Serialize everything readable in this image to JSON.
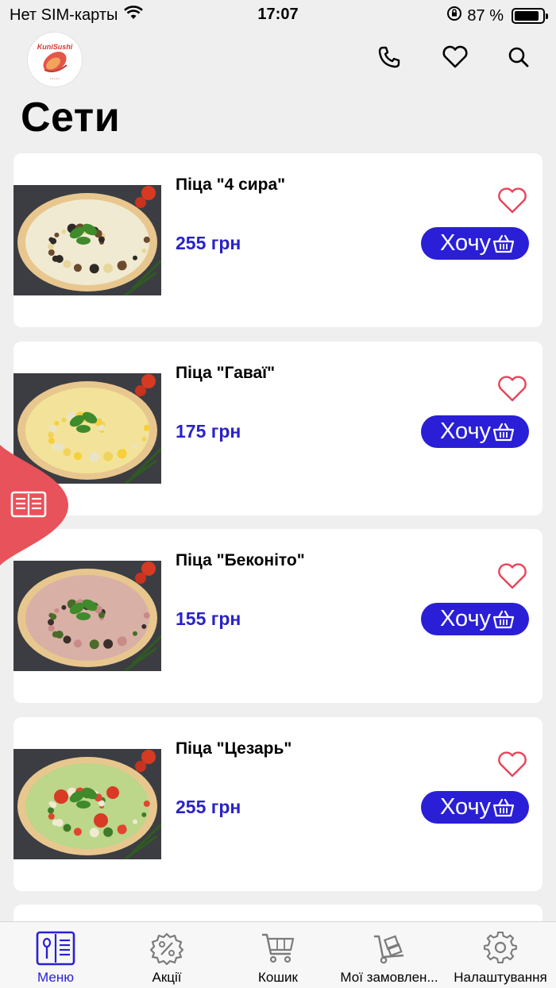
{
  "status": {
    "carrier": "Нет SIM-карты",
    "time": "17:07",
    "battery_text": "87 %",
    "battery_level": 0.87
  },
  "header": {
    "logo_text": "KuniSushi",
    "phone_icon": "phone-icon",
    "favorites_icon": "heart-icon",
    "search_icon": "search-icon"
  },
  "page": {
    "title": "Сети"
  },
  "products": [
    {
      "name": "Піца \"4 сира\"",
      "price": "255 грн",
      "button": "Хочу",
      "variant": "four-cheese"
    },
    {
      "name": "Піца \"Гаваї\"",
      "price": "175 грн",
      "button": "Хочу",
      "variant": "hawaii"
    },
    {
      "name": "Піца \"Беконіто\"",
      "price": "155 грн",
      "button": "Хочу",
      "variant": "baconito"
    },
    {
      "name": "Піца \"Цезарь\"",
      "price": "255 грн",
      "button": "Хочу",
      "variant": "caesar"
    }
  ],
  "tabbar": {
    "items": [
      {
        "label": "Меню",
        "icon": "menu-book-icon",
        "active": true
      },
      {
        "label": "Акції",
        "icon": "discount-gear-icon",
        "active": false
      },
      {
        "label": "Кошик",
        "icon": "cart-icon",
        "active": false
      },
      {
        "label": "Мої замовлен...",
        "icon": "delivery-cart-icon",
        "active": false
      },
      {
        "label": "Налаштування",
        "icon": "settings-icon",
        "active": false
      }
    ]
  },
  "colors": {
    "accent": "#2a1fd6",
    "price": "#2a22c9",
    "favorite": "#e8455a",
    "side_tab": "#e8525a"
  }
}
